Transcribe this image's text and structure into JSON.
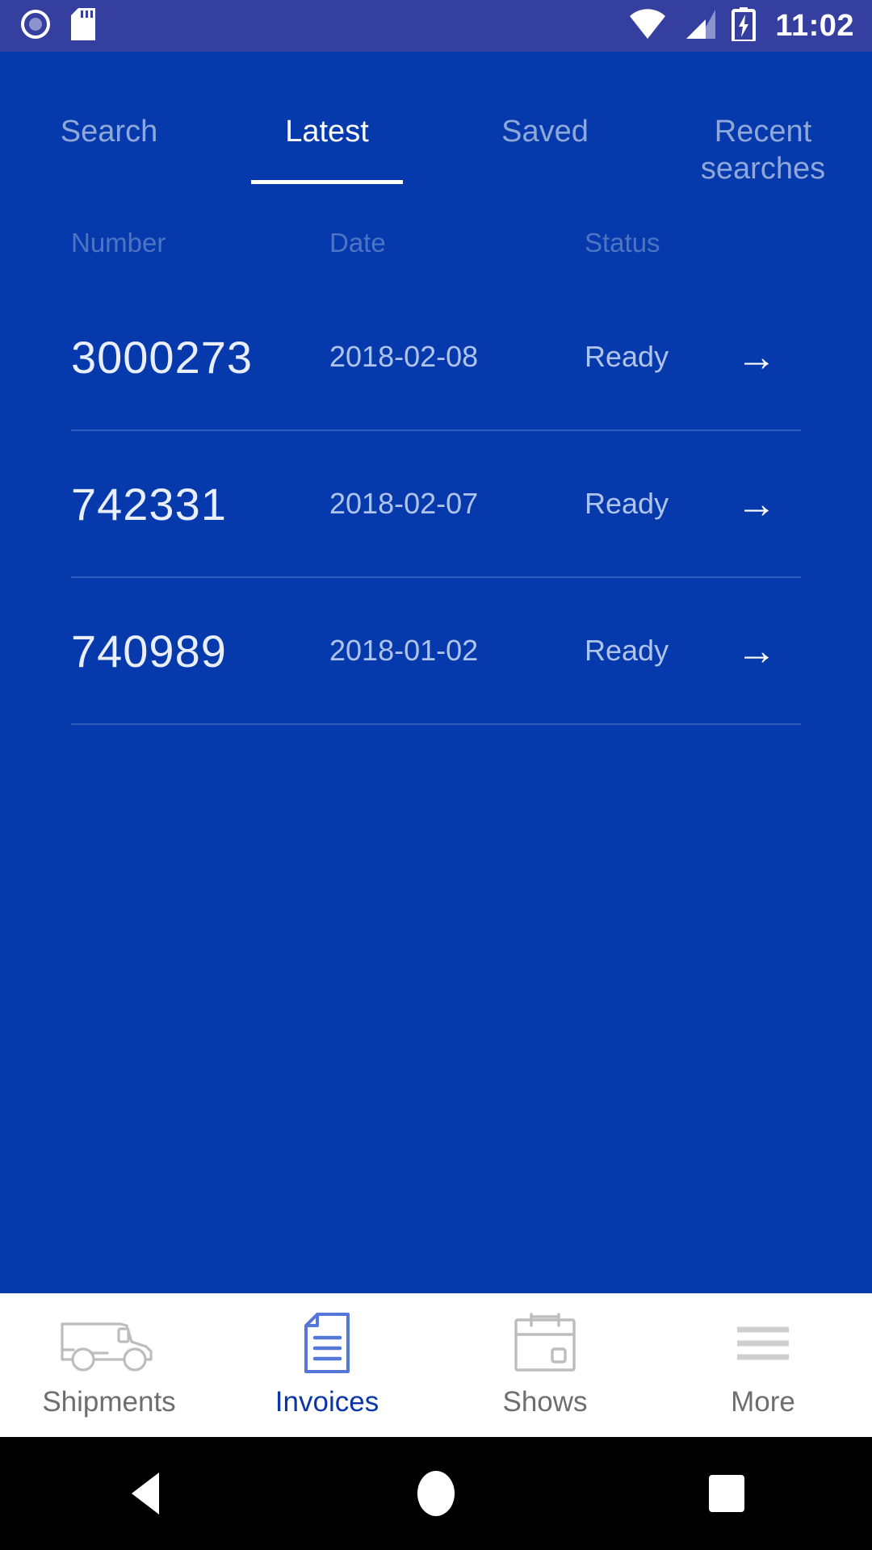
{
  "status_bar": {
    "icons": [
      "record-circle-icon",
      "sd-card-icon",
      "wifi-icon",
      "cell-signal-icon",
      "battery-charging-icon"
    ],
    "time": "11:02"
  },
  "tabs": [
    {
      "label": "Search",
      "active": false
    },
    {
      "label": "Latest",
      "active": true
    },
    {
      "label": "Saved",
      "active": false
    },
    {
      "label": "Recent searches",
      "active": false
    }
  ],
  "table": {
    "headers": {
      "number": "Number",
      "date": "Date",
      "status": "Status"
    },
    "rows": [
      {
        "number": "3000273",
        "date": "2018-02-08",
        "status": "Ready",
        "arrow": "→"
      },
      {
        "number": "742331",
        "date": "2018-02-07",
        "status": "Ready",
        "arrow": "→"
      },
      {
        "number": "740989",
        "date": "2018-01-02",
        "status": "Ready",
        "arrow": "→"
      }
    ]
  },
  "bottom_nav": [
    {
      "label": "Shipments",
      "icon": "truck-icon",
      "active": false
    },
    {
      "label": "Invoices",
      "icon": "document-icon",
      "active": true
    },
    {
      "label": "Shows",
      "icon": "calendar-icon",
      "active": false
    },
    {
      "label": "More",
      "icon": "hamburger-icon",
      "active": false
    }
  ],
  "android_nav": {
    "back": "back-triangle",
    "home": "home-circle",
    "recents": "recents-square"
  },
  "colors": {
    "status_bar_bg": "#343FA0",
    "app_bg": "#0639AC",
    "accent": "#0A36A8",
    "inactive_text": "#8FA8DA",
    "divider": "#2F5CBB",
    "nav_bg": "#ffffff",
    "android_nav_bg": "#000000"
  }
}
